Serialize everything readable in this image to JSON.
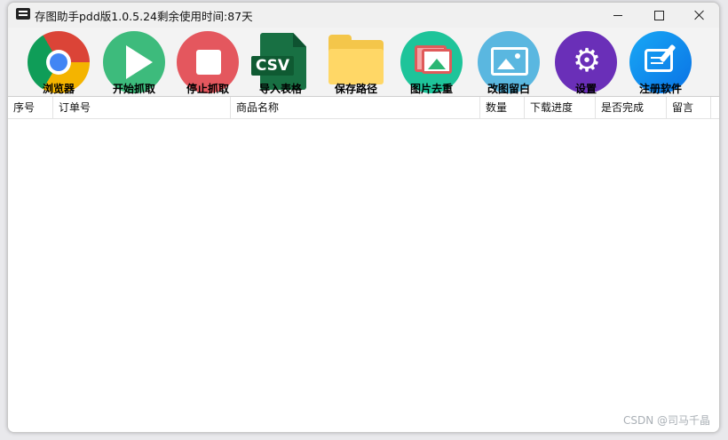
{
  "window": {
    "title": "存图助手pdd版1.0.5.24",
    "remaining": "剩余使用时间:87天"
  },
  "toolbar": {
    "items": [
      {
        "label": "浏览器",
        "icon": "chrome-icon"
      },
      {
        "label": "开始抓取",
        "icon": "play-icon"
      },
      {
        "label": "停止抓取",
        "icon": "stop-icon"
      },
      {
        "label": "导入表格",
        "icon": "csv-icon",
        "tag": "CSV"
      },
      {
        "label": "保存路径",
        "icon": "folder-icon"
      },
      {
        "label": "图片去重",
        "icon": "photos-icon"
      },
      {
        "label": "改图留白",
        "icon": "image-icon"
      },
      {
        "label": "设置",
        "icon": "gear-icon"
      },
      {
        "label": "注册软件",
        "icon": "register-icon"
      }
    ]
  },
  "table": {
    "columns": [
      "序号",
      "订单号",
      "商品名称",
      "数量",
      "下载进度",
      "是否完成",
      "留言"
    ],
    "rows": []
  },
  "watermark": "CSDN @司马千晶",
  "colors": {
    "play": "#3dbb7c",
    "stop": "#e4575e",
    "csv": "#187043",
    "folder": "#ffd766",
    "dedupe": "#1ec49a",
    "image": "#5ab7e0",
    "settings": "#6a2fb8",
    "register": "#0a72e5"
  }
}
